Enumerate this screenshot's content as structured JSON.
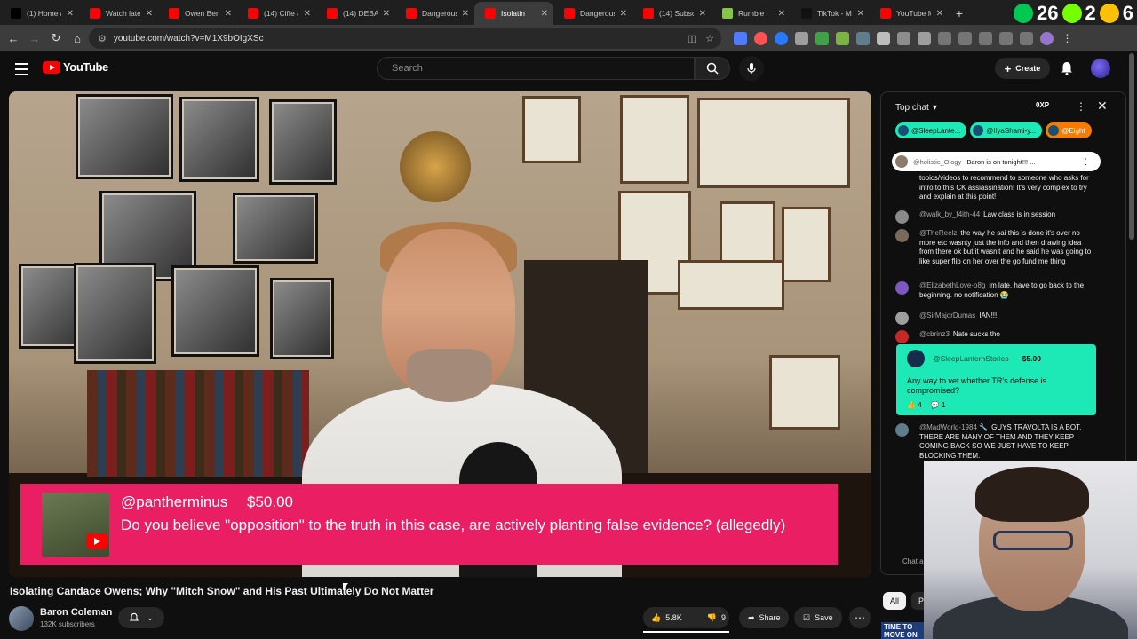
{
  "browser": {
    "tabs": [
      {
        "title": "(1) Home /",
        "favicon": "x-icon",
        "color": "#000000"
      },
      {
        "title": "Watch late",
        "favicon": "youtube-icon",
        "color": "#ff0000"
      },
      {
        "title": "Owen Benj",
        "favicon": "youtube-icon",
        "color": "#ff0000"
      },
      {
        "title": "(14) Ciffe &",
        "favicon": "youtube-icon",
        "color": "#ff0000"
      },
      {
        "title": "(14) DEBAT",
        "favicon": "youtube-icon",
        "color": "#ff0000"
      },
      {
        "title": "Dangerous",
        "favicon": "youtube-icon",
        "color": "#ff0000"
      },
      {
        "title": "Isolatin",
        "favicon": "youtube-icon",
        "color": "#ff0000",
        "active": true
      },
      {
        "title": "Dangerous",
        "favicon": "youtube-icon",
        "color": "#ff0000"
      },
      {
        "title": "(14) Subsc",
        "favicon": "youtube-icon",
        "color": "#ff0000"
      },
      {
        "title": "Rumble",
        "favicon": "rumble-icon",
        "color": "#85c742"
      },
      {
        "title": "TikTok - M",
        "favicon": "tiktok-icon",
        "color": "#111111"
      },
      {
        "title": "YouTube M",
        "favicon": "youtube-icon",
        "color": "#ff0000"
      }
    ],
    "new_tab": "+",
    "tab_badge_1": "26",
    "tab_badge_2": "2",
    "tab_badge_3": "6",
    "url": "youtube.com/watch?v=M1X9bOIgXSc"
  },
  "masthead": {
    "logo_text": "YouTube",
    "search_placeholder": "Search",
    "create_label": "Create"
  },
  "superchat_banner": {
    "user": "@pantherminus",
    "amount": "$50.00",
    "message": "Do you believe \"opposition\" to the truth in this case, are actively planting false evidence? (allegedly)"
  },
  "video": {
    "title": "Isolating Candace Owens; Why \"Mitch Snow\" and His Past Ultimately Do Not Matter",
    "channel": "Baron Coleman",
    "subscribers": "132K subscribers",
    "likes": "5.8K",
    "dislikes": "9",
    "share_label": "Share",
    "save_label": "Save",
    "like_ratio": 0.998
  },
  "chat": {
    "mode": "Top chat",
    "xp": "0XP",
    "tickers": [
      "@SleepLante...",
      "@IlyaShami-y...",
      "@Eight"
    ],
    "pinned_author": "@holistic_Ology",
    "pinned_message": "Baron is on tonight!!! ...",
    "messages": [
      {
        "author": "",
        "text": "topics/videos to recommend to someone who asks for intro to this CK assiassination! It's very complex to try and explain at this point!"
      },
      {
        "author": "@walk_by_f4ith-44",
        "text": "Law class is in session"
      },
      {
        "author": "@TheReelz",
        "text": "the way he sai this is done it's over no more etc wasnty just the info and then drawing idea from there ok but it wasn't and he said he was going to like super flip on her over the go fund me thing"
      },
      {
        "author": "@ElizabethLove-o8g",
        "text": "im late. have to go back to the beginning. no notification 😭"
      },
      {
        "author": "@SirMajorDumas",
        "text": "IAN!!!!"
      },
      {
        "author": "@cbrinz3",
        "text": "Nate sucks tho"
      },
      {
        "author": "@MadWorld-1984 🔧",
        "text": "GUYS TRAVOLTA IS A BOT. THERE ARE MANY OF THEM AND THEY KEEP COMING BACK SO WE JUST HAVE TO KEEP BLOCKING THEM."
      }
    ],
    "superchat": {
      "author": "@SleepLanternStories",
      "amount": "$5.00",
      "message": "Any way to vet whether TR's defense is compromised?",
      "likes": "4",
      "replies": "1"
    },
    "input_hint": "Chat a"
  },
  "side": {
    "filter_all": "All",
    "filter_next": "Po",
    "ad_text": "TIME TO MOVE ON"
  },
  "colors": {
    "superchat_red": "#e91e63",
    "superchat_teal": "#1de9b6",
    "youtube_red": "#ff0000"
  }
}
